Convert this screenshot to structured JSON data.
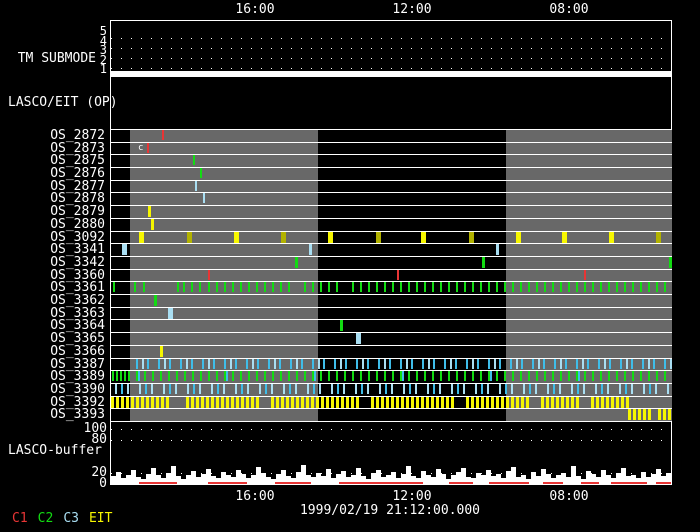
{
  "chart_data": {
    "type": "timeline",
    "description": "SOHO LASCO/EIT observing-sequence telemetry timeline display",
    "colors": {
      "R": "#e83535",
      "G": "#12dc12",
      "C": "#3fbde9",
      "P": "#a9def2",
      "Y": "#f6f600",
      "O": "#b2b200",
      "gray_band": "#686868",
      "white": "#ffffff"
    },
    "time_axis": {
      "major_ticks": [
        {
          "label": "16:00",
          "x": 145
        },
        {
          "label": "12:00",
          "x": 302
        },
        {
          "label": "08:00",
          "x": 459
        }
      ],
      "hour_ticks_x": [
        28,
        67,
        106,
        185,
        224,
        263,
        342,
        381,
        420,
        499,
        538
      ],
      "datetime": "1999/02/19 21:12:00.000"
    },
    "tm_submode": {
      "label": "TM SUBMODE",
      "scale": [
        "5",
        "4",
        "3",
        "2",
        "1"
      ],
      "grid_y": [
        17,
        27,
        37,
        47
      ],
      "value": 1
    },
    "lasco_eit": {
      "label": "LASCO/EIT (OP)",
      "events": []
    },
    "gray_bands": [
      [
        19,
        207
      ],
      [
        395,
        561
      ]
    ],
    "os_rows": [
      {
        "label": "OS_2872",
        "ticks": [
          [
            51,
            "R",
            2
          ]
        ]
      },
      {
        "label": "OS_2873",
        "ticks": [
          [
            36,
            "R",
            2
          ]
        ],
        "note": {
          "text": "c",
          "x": 27
        }
      },
      {
        "label": "OS_2875",
        "ticks": [
          [
            82,
            "G",
            2
          ]
        ]
      },
      {
        "label": "OS_2876",
        "ticks": [
          [
            89,
            "G",
            2
          ]
        ]
      },
      {
        "label": "OS_2877",
        "ticks": [
          [
            84,
            "P",
            2
          ]
        ]
      },
      {
        "label": "OS_2878",
        "ticks": [
          [
            92,
            "P",
            2
          ]
        ]
      },
      {
        "label": "OS_2879",
        "ticks": [
          [
            37,
            "Y",
            3
          ]
        ]
      },
      {
        "label": "OS_2880",
        "ticks": [
          [
            40,
            "Y",
            3
          ]
        ]
      },
      {
        "label": "OS_3092",
        "ticks": [
          [
            28,
            "Y",
            5
          ],
          [
            76,
            "O",
            5
          ],
          [
            123,
            "Y",
            5
          ],
          [
            170,
            "O",
            5
          ],
          [
            217,
            "Y",
            5
          ],
          [
            265,
            "O",
            5
          ],
          [
            310,
            "Y",
            5
          ],
          [
            358,
            "O",
            5
          ],
          [
            405,
            "Y",
            5
          ],
          [
            451,
            "Y",
            5
          ],
          [
            498,
            "Y",
            5
          ],
          [
            545,
            "O",
            5
          ]
        ]
      },
      {
        "label": "OS_3341",
        "ticks": [
          [
            11,
            "P",
            5
          ],
          [
            198,
            "P",
            3
          ],
          [
            385,
            "P",
            3
          ]
        ]
      },
      {
        "label": "OS_3342",
        "ticks": [
          [
            184,
            "G",
            3
          ],
          [
            371,
            "G",
            3
          ],
          [
            558,
            "G",
            3
          ]
        ]
      },
      {
        "label": "OS_3360",
        "ticks": [
          [
            97,
            "R",
            2
          ],
          [
            286,
            "R",
            2
          ],
          [
            473,
            "R",
            2
          ]
        ]
      },
      {
        "label": "OS_3361",
        "ticks": [
          [
            2,
            "G",
            2
          ],
          [
            23,
            "G",
            2
          ],
          [
            32,
            "G",
            2
          ],
          [
            66,
            "G",
            2
          ],
          [
            72,
            "G",
            2
          ],
          [
            80,
            "G",
            2
          ],
          [
            88,
            "G",
            2
          ]
        ],
        "runs": [
          {
            "from": 97,
            "to": 553,
            "step": 8,
            "w": 2,
            "c": "G",
            "gaps": [
              [
                182,
                188
              ],
              [
                230,
                236
              ]
            ]
          }
        ]
      },
      {
        "label": "OS_3362",
        "ticks": [
          [
            43,
            "G",
            3
          ]
        ]
      },
      {
        "label": "OS_3363",
        "ticks": [
          [
            57,
            "P",
            5
          ]
        ]
      },
      {
        "label": "OS_3364",
        "ticks": [
          [
            229,
            "G",
            3
          ]
        ]
      },
      {
        "label": "OS_3365",
        "ticks": [
          [
            245,
            "P",
            5
          ]
        ]
      },
      {
        "label": "OS_3366",
        "ticks": [
          [
            49,
            "Y",
            3
          ]
        ]
      },
      {
        "label": "OS_3387",
        "runs": [
          {
            "from": 25,
            "to": 553,
            "step": 11,
            "w": 2,
            "c": "C"
          },
          {
            "from": 31,
            "to": 559,
            "step": 22,
            "w": 2,
            "c": "P"
          }
        ]
      },
      {
        "label": "OS_3389",
        "ticks": [
          [
            1,
            "G",
            2
          ],
          [
            5,
            "G",
            2
          ],
          [
            9,
            "G",
            2
          ],
          [
            13,
            "G",
            2
          ],
          [
            27,
            "C",
            2
          ],
          [
            115,
            "C",
            2
          ],
          [
            203,
            "C",
            2
          ],
          [
            291,
            "C",
            2
          ],
          [
            379,
            "C",
            2
          ],
          [
            467,
            "C",
            2
          ]
        ],
        "runs": [
          {
            "from": 17,
            "to": 553,
            "step": 8,
            "w": 2,
            "c": "G"
          }
        ]
      },
      {
        "label": "OS_3390",
        "runs": [
          {
            "from": 4,
            "to": 556,
            "step": 12,
            "w": 2,
            "c": "P"
          },
          {
            "from": 10,
            "to": 556,
            "step": 24,
            "w": 2,
            "c": "C"
          }
        ]
      },
      {
        "label": "OS_3392",
        "runs": [
          {
            "from": 0,
            "to": 516,
            "step": 5,
            "w": 3,
            "c": "Y",
            "gaps": [
              [
                57,
                70
              ],
              [
                150,
                158
              ],
              [
                249,
                257
              ],
              [
                344,
                352
              ],
              [
                419,
                427
              ],
              [
                469,
                477
              ]
            ]
          }
        ]
      },
      {
        "label": "OS_3393",
        "runs": [
          {
            "from": 517,
            "to": 558,
            "step": 5,
            "w": 3,
            "c": "Y",
            "gaps": [
              [
                540,
                546
              ]
            ]
          }
        ]
      }
    ],
    "buffer": {
      "label": "LASCO-buffer",
      "scale": [
        {
          "t": "100",
          "v": 100
        },
        {
          "t": "80",
          "v": 80
        },
        {
          "t": "20",
          "v": 20
        },
        {
          "t": "0",
          "v": 0
        }
      ],
      "gridline_values": [
        100,
        80,
        20
      ],
      "ylim": [
        0,
        110
      ],
      "heights": [
        15,
        22,
        11,
        16,
        25,
        13,
        9,
        18,
        29,
        16,
        11,
        20,
        33,
        15,
        9,
        16,
        24,
        13,
        18,
        27,
        15,
        11,
        22,
        16,
        13,
        25,
        18,
        11,
        16,
        31,
        20,
        13,
        9,
        18,
        25,
        15,
        11,
        22,
        35,
        16,
        13,
        20,
        15,
        27,
        11,
        18,
        24,
        13,
        16,
        29,
        15,
        9,
        20,
        25,
        13,
        16,
        22,
        11,
        18,
        33,
        15,
        11,
        24,
        16,
        13,
        27,
        18,
        9,
        16,
        22,
        29,
        13,
        11,
        20,
        16,
        25,
        15,
        18,
        11,
        24,
        31,
        13,
        16,
        9,
        22,
        15,
        27,
        18,
        11,
        16,
        20,
        13,
        33,
        15,
        9,
        24,
        18,
        13,
        25,
        16,
        11,
        20,
        29,
        15,
        16,
        11,
        22,
        13,
        18,
        27,
        15,
        20
      ],
      "red_segments": [
        [
          28,
          66
        ],
        [
          97,
          136
        ],
        [
          164,
          200
        ],
        [
          228,
          312
        ],
        [
          338,
          362
        ],
        [
          378,
          418
        ],
        [
          432,
          452
        ],
        [
          470,
          488
        ],
        [
          500,
          536
        ],
        [
          545,
          560
        ]
      ]
    },
    "legend": [
      {
        "label": "C1",
        "c": "R"
      },
      {
        "label": "C2",
        "c": "G"
      },
      {
        "label": "C3",
        "c": "P"
      },
      {
        "label": "EIT",
        "c": "Y"
      }
    ]
  }
}
